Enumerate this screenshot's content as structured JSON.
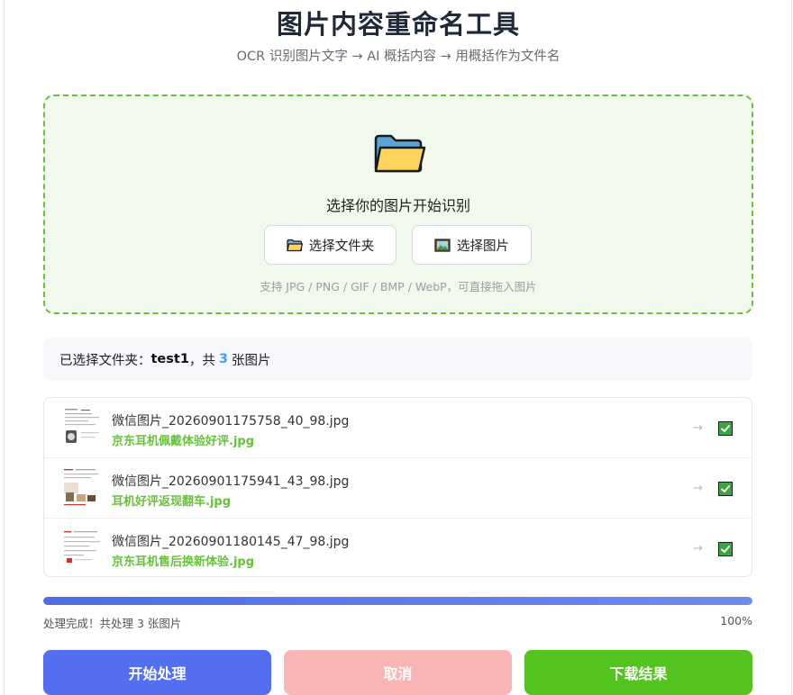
{
  "header": {
    "title": "图片内容重命名工具",
    "subtitle": "OCR 识别图片文字 → AI 概括内容 → 用概括作为文件名"
  },
  "dropzone": {
    "icon": "folder-icon",
    "prompt": "选择你的图片开始识别",
    "select_folder_label": "选择文件夹",
    "select_folder_icon": "folder-icon",
    "select_image_label": "选择图片",
    "select_image_icon": "image-icon",
    "hint": "支持 JPG / PNG / GIF / BMP / WebP，可直接拖入图片"
  },
  "summary": {
    "prefix": "已选择文件夹：",
    "folder_name": "test1",
    "middle": "，共",
    "count": "3",
    "suffix": "张图片"
  },
  "files": [
    {
      "original": "微信图片_20260901175758_40_98.jpg",
      "renamed": "京东耳机佩戴体验好评.jpg",
      "arrow": "→",
      "checked": true
    },
    {
      "original": "微信图片_20260901175941_43_98.jpg",
      "renamed": "耳机好评返现翻车.jpg",
      "arrow": "→",
      "checked": true
    },
    {
      "original": "微信图片_20260901180145_47_98.jpg",
      "renamed": "京东耳机售后换新体验.jpg",
      "arrow": "→",
      "checked": true
    }
  ],
  "progress": {
    "percent": 100,
    "status": "处理完成！共处理 3 张图片",
    "percent_label": "100%"
  },
  "actions": {
    "start_label": "开始处理",
    "cancel_label": "取消",
    "download_label": "下载结果"
  },
  "colors": {
    "accent": "#536ef0",
    "success": "#53c41f",
    "danger_disabled": "#fab6b6",
    "dropzone_border": "#67c23a",
    "count_highlight": "#409eff"
  }
}
